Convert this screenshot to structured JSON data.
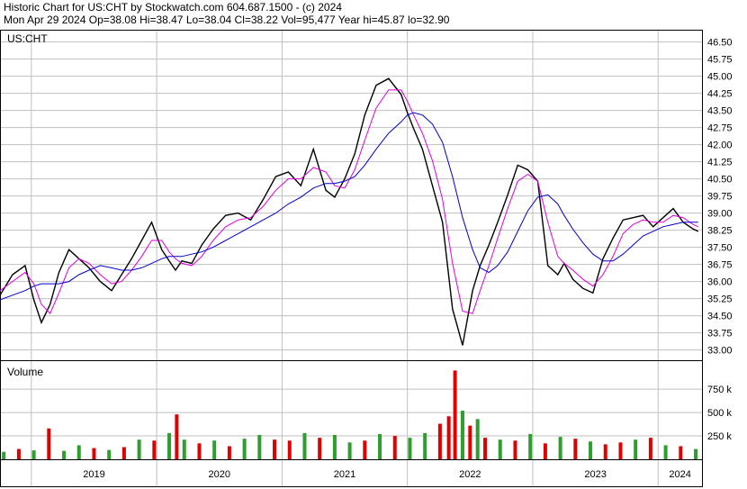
{
  "header": {
    "line1": "Historic Chart for US:CHT by Stockwatch.com 604.687.1500 - (c) 2024",
    "line2": "Mon Apr 29 2024   Op=38.08  Hi=38.47  Lo=38.04  Cl=38.22  Vol=95,477  Year hi=45.87  lo=32.90"
  },
  "chart_data": {
    "type": "line",
    "symbol_label": "US:CHT",
    "volume_label": "Volume",
    "price_ticks": [
      "46.50",
      "45.75",
      "45.00",
      "44.25",
      "43.50",
      "42.75",
      "42.00",
      "41.25",
      "40.50",
      "39.75",
      "39.00",
      "38.25",
      "37.50",
      "36.75",
      "36.00",
      "35.25",
      "34.50",
      "33.75",
      "33.00"
    ],
    "price_tick_values": [
      46.5,
      45.75,
      45.0,
      44.25,
      43.5,
      42.75,
      42.0,
      41.25,
      40.5,
      39.75,
      39.0,
      38.25,
      37.5,
      36.75,
      36.0,
      35.25,
      34.5,
      33.75,
      33.0
    ],
    "price_ylim": [
      32.55,
      47.0
    ],
    "volume_ticks": [
      "750 k",
      "500 k",
      "250 k"
    ],
    "volume_tick_values": [
      750000,
      500000,
      250000
    ],
    "volume_ylim": [
      0,
      1050000
    ],
    "x_years": [
      "2019",
      "2020",
      "2021",
      "2022",
      "2023",
      "2024"
    ],
    "x_range": [
      2018.75,
      2024.35
    ],
    "grid": true,
    "colors": {
      "price": "#000000",
      "ma_short": "#e000e0",
      "ma_long": "#0000cc",
      "vol_up": "#2e9e2e",
      "vol_down": "#e00000",
      "grid": "#c0c0c0"
    },
    "price_series": {
      "x": [
        2018.75,
        2018.85,
        2018.95,
        2019.02,
        2019.08,
        2019.15,
        2019.22,
        2019.3,
        2019.38,
        2019.46,
        2019.55,
        2019.64,
        2019.72,
        2019.8,
        2019.88,
        2019.96,
        2020.04,
        2020.1,
        2020.15,
        2020.2,
        2020.28,
        2020.36,
        2020.45,
        2020.55,
        2020.65,
        2020.75,
        2020.85,
        2020.95,
        2021.05,
        2021.15,
        2021.25,
        2021.35,
        2021.42,
        2021.5,
        2021.58,
        2021.66,
        2021.75,
        2021.85,
        2021.95,
        2022.0,
        2022.05,
        2022.12,
        2022.2,
        2022.28,
        2022.36,
        2022.44,
        2022.52,
        2022.58,
        2022.65,
        2022.72,
        2022.8,
        2022.88,
        2022.96,
        2023.04,
        2023.12,
        2023.2,
        2023.25,
        2023.32,
        2023.4,
        2023.48,
        2023.56,
        2023.64,
        2023.72,
        2023.8,
        2023.88,
        2023.96,
        2024.04,
        2024.12,
        2024.2,
        2024.28,
        2024.32
      ],
      "close": [
        35.4,
        36.3,
        36.7,
        35.2,
        34.2,
        35.0,
        36.4,
        37.4,
        37.0,
        36.6,
        36.0,
        35.6,
        36.3,
        37.0,
        37.8,
        38.6,
        37.4,
        36.9,
        36.5,
        36.9,
        36.8,
        37.6,
        38.3,
        38.9,
        39.0,
        38.7,
        39.6,
        40.6,
        40.8,
        40.2,
        41.8,
        40.0,
        39.7,
        40.5,
        41.6,
        43.3,
        44.6,
        44.9,
        44.2,
        43.4,
        42.7,
        41.8,
        40.2,
        38.6,
        34.8,
        33.2,
        35.6,
        36.7,
        37.6,
        38.6,
        39.8,
        41.1,
        40.9,
        40.4,
        36.7,
        36.3,
        36.8,
        36.1,
        35.7,
        35.5,
        37.0,
        37.9,
        38.7,
        38.8,
        38.9,
        38.4,
        38.8,
        39.2,
        38.6,
        38.3,
        38.2
      ],
      "ma_short": [
        35.6,
        36.0,
        36.4,
        35.9,
        35.0,
        34.6,
        35.5,
        36.6,
        37.0,
        36.8,
        36.3,
        35.9,
        36.0,
        36.5,
        37.1,
        37.8,
        37.8,
        37.3,
        37.0,
        36.8,
        36.7,
        37.1,
        37.8,
        38.4,
        38.7,
        38.8,
        39.3,
        40.0,
        40.5,
        40.5,
        41.0,
        40.8,
        40.2,
        40.1,
        40.9,
        42.2,
        43.6,
        44.4,
        44.4,
        43.9,
        43.3,
        42.5,
        41.3,
        39.6,
        36.8,
        34.7,
        34.6,
        35.6,
        36.7,
        37.9,
        39.2,
        40.4,
        40.7,
        40.4,
        38.6,
        37.1,
        36.8,
        36.5,
        36.1,
        35.8,
        36.3,
        37.1,
        38.1,
        38.5,
        38.7,
        38.6,
        38.6,
        38.9,
        38.8,
        38.5,
        38.4
      ],
      "ma_long": [
        35.2,
        35.4,
        35.6,
        35.8,
        35.9,
        35.9,
        35.9,
        36.0,
        36.3,
        36.5,
        36.7,
        36.6,
        36.5,
        36.5,
        36.6,
        36.8,
        37.0,
        37.1,
        37.1,
        37.1,
        37.2,
        37.3,
        37.5,
        37.8,
        38.1,
        38.4,
        38.7,
        39.0,
        39.4,
        39.7,
        40.1,
        40.3,
        40.3,
        40.4,
        40.6,
        41.1,
        41.8,
        42.5,
        43.0,
        43.3,
        43.4,
        43.3,
        42.9,
        42.1,
        40.6,
        38.8,
        37.4,
        36.6,
        36.4,
        36.7,
        37.3,
        38.2,
        39.1,
        39.7,
        39.8,
        39.4,
        38.9,
        38.3,
        37.7,
        37.2,
        36.9,
        36.9,
        37.2,
        37.6,
        38.0,
        38.2,
        38.4,
        38.5,
        38.6,
        38.6,
        38.6
      ]
    },
    "volume_series": {
      "x": [
        2018.78,
        2018.9,
        2019.02,
        2019.14,
        2019.26,
        2019.38,
        2019.5,
        2019.62,
        2019.74,
        2019.86,
        2019.98,
        2020.1,
        2020.16,
        2020.22,
        2020.34,
        2020.46,
        2020.58,
        2020.7,
        2020.82,
        2020.94,
        2021.06,
        2021.18,
        2021.3,
        2021.42,
        2021.54,
        2021.66,
        2021.78,
        2021.9,
        2022.02,
        2022.14,
        2022.26,
        2022.33,
        2022.38,
        2022.44,
        2022.5,
        2022.56,
        2022.62,
        2022.74,
        2022.86,
        2022.98,
        2023.1,
        2023.22,
        2023.34,
        2023.46,
        2023.58,
        2023.7,
        2023.82,
        2023.94,
        2024.06,
        2024.18,
        2024.3
      ],
      "values": [
        80000,
        110000,
        95000,
        330000,
        90000,
        150000,
        120000,
        100000,
        130000,
        210000,
        200000,
        280000,
        480000,
        210000,
        170000,
        200000,
        140000,
        220000,
        260000,
        210000,
        200000,
        280000,
        230000,
        260000,
        180000,
        200000,
        270000,
        250000,
        230000,
        280000,
        380000,
        460000,
        950000,
        520000,
        360000,
        430000,
        230000,
        210000,
        200000,
        270000,
        170000,
        240000,
        220000,
        190000,
        160000,
        180000,
        210000,
        230000,
        150000,
        140000,
        110000
      ],
      "up": [
        true,
        false,
        true,
        false,
        true,
        true,
        false,
        true,
        false,
        true,
        false,
        true,
        false,
        true,
        false,
        true,
        false,
        true,
        true,
        false,
        false,
        true,
        false,
        true,
        true,
        false,
        true,
        false,
        true,
        true,
        false,
        false,
        false,
        true,
        false,
        true,
        false,
        true,
        false,
        true,
        false,
        true,
        false,
        true,
        false,
        false,
        true,
        false,
        true,
        false,
        true
      ]
    }
  }
}
